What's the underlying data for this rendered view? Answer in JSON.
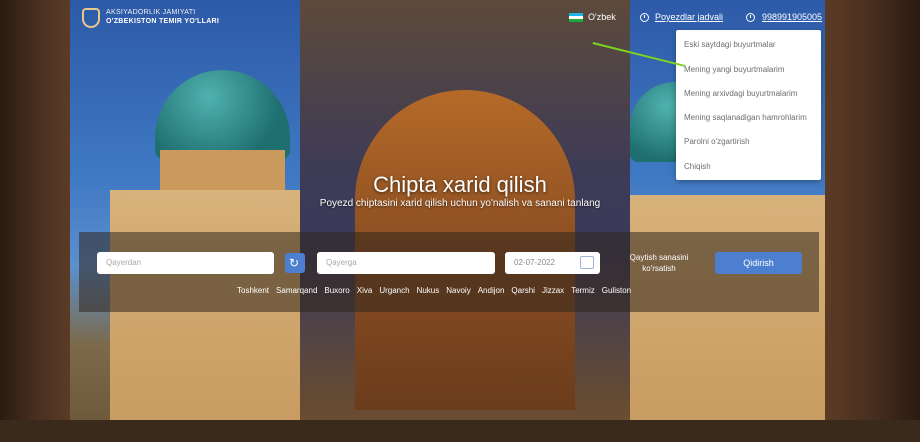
{
  "header": {
    "logo_line1": "AKSIYADORLIK JAMIYATI",
    "logo_line2": "O'ZBEKISTON TEMIR YO'LLARI",
    "language": "O'zbek",
    "schedule_link": "Poyezdlar jadvali",
    "user_phone": "998991905005"
  },
  "user_menu": {
    "items": [
      {
        "label": "Eski saytdagi buyurtmalar"
      },
      {
        "label": "Mening yangi buyurtmalarim"
      },
      {
        "label": "Mening arxivdagi buyurtmalarim"
      },
      {
        "label": "Mening saqlanadigan hamrohlarim"
      },
      {
        "label": "Parolni o'zgartirish"
      },
      {
        "label": "Chiqish"
      }
    ]
  },
  "hero": {
    "title": "Chipta xarid qilish",
    "subtitle": "Poyezd chiptasini xarid qilish uchun yo'nalish va sanani tanlang"
  },
  "search": {
    "from_placeholder": "Qayerdan",
    "to_placeholder": "Qayerga",
    "date_value": "02-07-2022",
    "return_label": "Qaytish sanasini ko'rsatish",
    "search_button": "Qidirish",
    "cities": [
      "Toshkent",
      "Samarqand",
      "Buxoro",
      "Xiva",
      "Urganch",
      "Nukus",
      "Navoiy",
      "Andijon",
      "Qarshi",
      "Jizzax",
      "Termiz",
      "Guliston"
    ]
  },
  "icons": {
    "logo": "railway-emblem-icon",
    "flag": "uzbekistan-flag-icon",
    "schedule": "clock-icon",
    "user": "user-icon",
    "swap": "refresh-icon",
    "calendar": "calendar-icon"
  },
  "colors": {
    "accent": "#4c7fd0",
    "annotation_arrow": "#7ed321"
  }
}
